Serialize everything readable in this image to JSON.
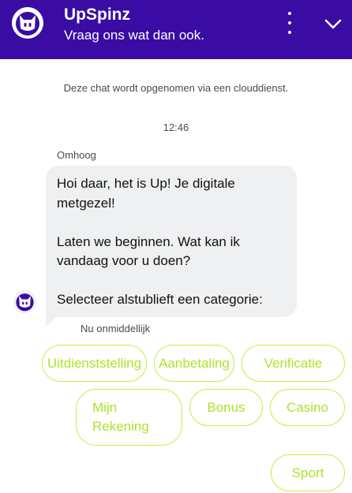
{
  "header": {
    "title": "UpSpinz",
    "subtitle": "Vraag ons wat dan ook.",
    "bg_color": "#3a0ca3",
    "menu_icon": "more-vertical-icon",
    "collapse_icon": "chevron-down-icon"
  },
  "chat": {
    "notice": "Deze chat wordt opgenomen via een clouddienst.",
    "timestamp": "12:46",
    "message": {
      "sender": "Omhoog",
      "paragraphs": [
        "Hoi daar, het is Up! Je digitale metgezel!",
        "Laten we beginnen. Wat kan ik vandaag voor u doen?",
        "Selecteer alstublieft een categorie:"
      ],
      "meta": "Nu onmiddellijk"
    }
  },
  "quick_replies": [
    "Uitdienststelling",
    "Aanbetaling",
    "Verificatie",
    "Mijn Rekening",
    "Bonus",
    "Casino",
    "Sport"
  ],
  "colors": {
    "accent": "#abe32b",
    "bubble": "#eef0f2"
  }
}
